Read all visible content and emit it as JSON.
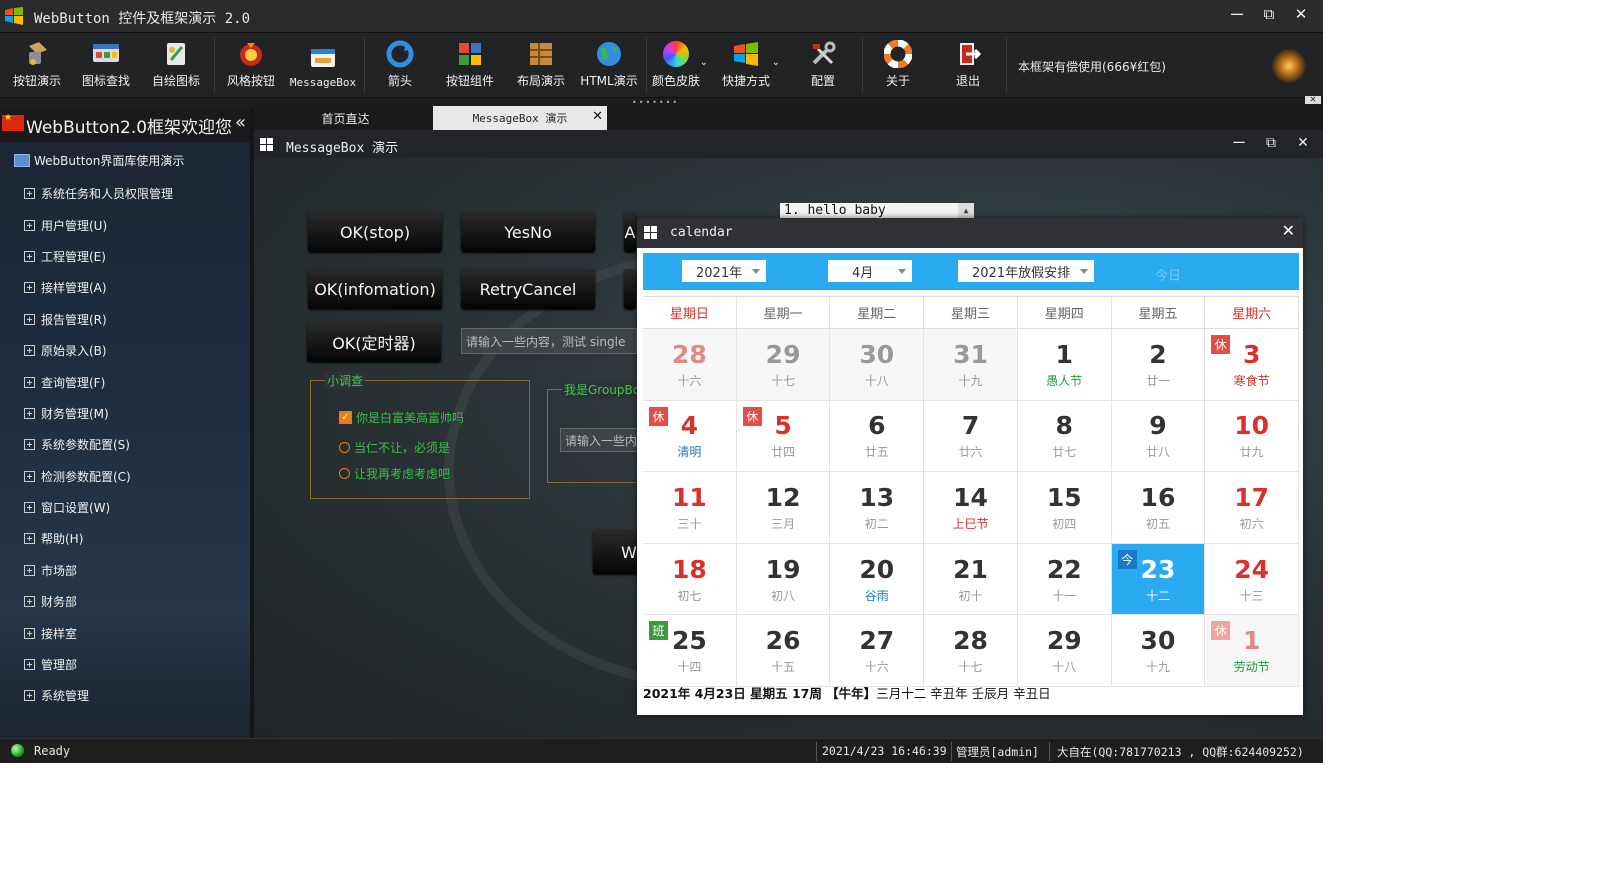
{
  "window": {
    "title": "WebButton 控件及框架演示 2.0",
    "minimize": "ー",
    "maximize": "⧉",
    "close": "✕"
  },
  "toolbar": {
    "items": [
      {
        "label": "按钮演示",
        "icon": "button-demo-icon"
      },
      {
        "label": "图标查找",
        "icon": "icon-search-icon"
      },
      {
        "label": "自绘图标",
        "icon": "self-draw-icon"
      },
      {
        "label": "风格按钮",
        "icon": "style-button-icon"
      },
      {
        "label": "MessageBox",
        "icon": "messagebox-icon"
      },
      {
        "label": "箭头",
        "icon": "arrow-icon"
      },
      {
        "label": "按钮组件",
        "icon": "puzzle-icon"
      },
      {
        "label": "布局演示",
        "icon": "layout-icon"
      },
      {
        "label": "HTML演示",
        "icon": "globe-icon"
      },
      {
        "label": "颜色皮肤",
        "icon": "color-wheel-icon"
      },
      {
        "label": "快捷方式",
        "icon": "windows-logo-icon"
      },
      {
        "label": "配置",
        "icon": "tools-icon"
      },
      {
        "label": "关于",
        "icon": "lifebuoy-icon"
      },
      {
        "label": "退出",
        "icon": "exit-door-icon"
      }
    ],
    "promo": "本框架有偿使用(666¥红包)"
  },
  "nav": {
    "title": "WebButton2.0框架欢迎您",
    "collapse": "«",
    "root": "WebButton界面库使用演示",
    "items": [
      "系统任务和人员权限管理",
      "用户管理(U)",
      "工程管理(E)",
      "接样管理(A)",
      "报告管理(R)",
      "原始录入(B)",
      "查询管理(F)",
      "财务管理(M)",
      "系统参数配置(S)",
      "检测参数配置(C)",
      "窗口设置(W)",
      "帮助(H)",
      "市场部",
      "财务部",
      "接样室",
      "管理部",
      "系统管理"
    ]
  },
  "tabs": [
    {
      "label": "首页直达"
    },
    {
      "label": "MessageBox 演示",
      "close": "✕"
    }
  ],
  "inner": {
    "title": "MessageBox 演示",
    "buttons": [
      "OK(stop)",
      "YesNo",
      "OK(infomation)",
      "RetryCancel",
      "OK(定时器)",
      "W"
    ],
    "partial_button": "A",
    "input1": "请输入一些内容，测试 single",
    "input2": "请输入一些内",
    "list_first": "1. hello baby",
    "group1": {
      "title": "小调查",
      "check": "你是白富美高富帅吗",
      "radio1": "当仁不让，必须是",
      "radio2": "让我再考虑考虑吧"
    },
    "group2_title": "我是GroupBo"
  },
  "calendar": {
    "title": "calendar",
    "year": "2021年",
    "month": "4月",
    "holiday": "2021年放假安排",
    "today_btn": "今日",
    "weekdays": [
      "星期日",
      "星期一",
      "星期二",
      "星期三",
      "星期四",
      "星期五",
      "星期六"
    ],
    "weeks": [
      [
        {
          "n": "28",
          "l": "十六",
          "cls": "other red"
        },
        {
          "n": "29",
          "l": "十七",
          "cls": "other"
        },
        {
          "n": "30",
          "l": "十八",
          "cls": "other"
        },
        {
          "n": "31",
          "l": "十九",
          "cls": "other"
        },
        {
          "n": "1",
          "l": "愚人节",
          "cls": "festg"
        },
        {
          "n": "2",
          "l": "廿一",
          "cls": ""
        },
        {
          "n": "3",
          "l": "寒食节",
          "cls": "red festr",
          "tag": "休",
          "tagcls": "rest"
        }
      ],
      [
        {
          "n": "4",
          "l": "清明",
          "cls": "red festb",
          "tag": "休",
          "tagcls": "rest"
        },
        {
          "n": "5",
          "l": "廿四",
          "cls": "red",
          "tag": "休",
          "tagcls": "rest"
        },
        {
          "n": "6",
          "l": "廿五",
          "cls": ""
        },
        {
          "n": "7",
          "l": "廿六",
          "cls": ""
        },
        {
          "n": "8",
          "l": "廿七",
          "cls": ""
        },
        {
          "n": "9",
          "l": "廿八",
          "cls": ""
        },
        {
          "n": "10",
          "l": "廿九",
          "cls": "red"
        }
      ],
      [
        {
          "n": "11",
          "l": "三十",
          "cls": "red"
        },
        {
          "n": "12",
          "l": "三月",
          "cls": ""
        },
        {
          "n": "13",
          "l": "初二",
          "cls": ""
        },
        {
          "n": "14",
          "l": "上巳节",
          "cls": "festr"
        },
        {
          "n": "15",
          "l": "初四",
          "cls": ""
        },
        {
          "n": "16",
          "l": "初五",
          "cls": ""
        },
        {
          "n": "17",
          "l": "初六",
          "cls": "red"
        }
      ],
      [
        {
          "n": "18",
          "l": "初七",
          "cls": "red"
        },
        {
          "n": "19",
          "l": "初八",
          "cls": ""
        },
        {
          "n": "20",
          "l": "谷雨",
          "cls": "festb"
        },
        {
          "n": "21",
          "l": "初十",
          "cls": ""
        },
        {
          "n": "22",
          "l": "十一",
          "cls": ""
        },
        {
          "n": "23",
          "l": "十二",
          "cls": "sel-today",
          "tag": "今",
          "tagcls": "now"
        },
        {
          "n": "24",
          "l": "十三",
          "cls": "red"
        }
      ],
      [
        {
          "n": "25",
          "l": "十四",
          "cls": "",
          "tag": "班",
          "tagcls": "work"
        },
        {
          "n": "26",
          "l": "十五",
          "cls": ""
        },
        {
          "n": "27",
          "l": "十六",
          "cls": ""
        },
        {
          "n": "28",
          "l": "十七",
          "cls": ""
        },
        {
          "n": "29",
          "l": "十八",
          "cls": ""
        },
        {
          "n": "30",
          "l": "十九",
          "cls": ""
        },
        {
          "n": "1",
          "l": "劳动节",
          "cls": "other red festg",
          "tag": "休",
          "tagcls": "rest"
        }
      ]
    ],
    "footer_bold": "2021年 4月23日 星期五 17周 【牛年】",
    "footer_rest": "三月十二 辛丑年 壬辰月 辛丑日"
  },
  "status": {
    "ready": "Ready",
    "datetime": "2021/4/23 16:46:39",
    "user": "管理员[admin]",
    "contact": "大自在(QQ:781770213 , QQ群:624409252)"
  },
  "colors": {
    "accent": "#2aaaf0",
    "holiday_red": "#d9312b",
    "festival_green": "#1aa038"
  }
}
